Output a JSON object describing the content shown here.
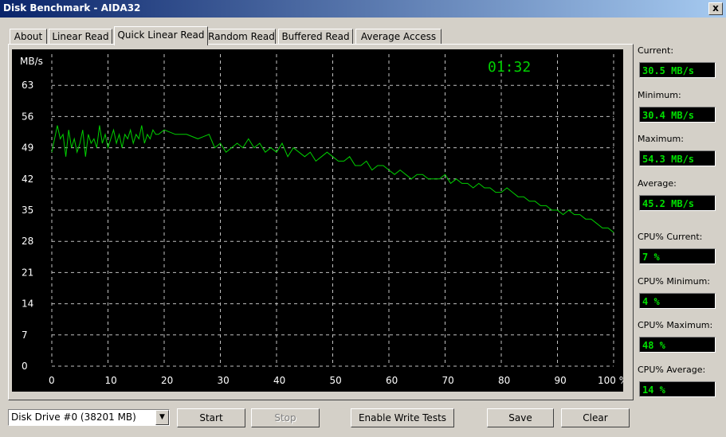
{
  "window": {
    "title": "Disk Benchmark - AIDA32",
    "close_label": "x"
  },
  "tabs": [
    {
      "label": "About",
      "active": false
    },
    {
      "label": "Linear Read",
      "active": false
    },
    {
      "label": "Quick Linear Read",
      "active": true
    },
    {
      "label": "Random Read",
      "active": false
    },
    {
      "label": "Buffered Read",
      "active": false
    },
    {
      "label": "Average Access",
      "active": false
    }
  ],
  "chart": {
    "clock": "01:32",
    "y_unit": "MB/s",
    "line_color": "#00d000",
    "grid_color": "#c0c0c0"
  },
  "chart_data": {
    "type": "line",
    "ylabel": "MB/s",
    "ylim": [
      0,
      70
    ],
    "xlim": [
      0,
      100
    ],
    "yticks": [
      "0",
      "7",
      "14",
      "21",
      "28",
      "35",
      "42",
      "49",
      "56",
      "63"
    ],
    "xticks": [
      "0",
      "10",
      "20",
      "30",
      "40",
      "50",
      "60",
      "70",
      "80",
      "90",
      "100 %"
    ],
    "grid": true,
    "series": [
      {
        "x": [
          0,
          1,
          1.5,
          2,
          2.5,
          3,
          3.5,
          4,
          4.5,
          5,
          5.5,
          6,
          6.5,
          7,
          7.5,
          8,
          8.5,
          9,
          9.5,
          10,
          10.5,
          11,
          11.5,
          12,
          12.5,
          13,
          13.5,
          14,
          14.5,
          15,
          15.5,
          16,
          16.5,
          17,
          17.5,
          18,
          18.5,
          19,
          20,
          22,
          24,
          26,
          28,
          29,
          30,
          31,
          32,
          33,
          34,
          35,
          36,
          37,
          38,
          39,
          40,
          41,
          42,
          43,
          44,
          45,
          46,
          47,
          48,
          49,
          50,
          51,
          52,
          53,
          54,
          55,
          56,
          57,
          58,
          59,
          60,
          61,
          62,
          63,
          64,
          65,
          66,
          67,
          68,
          69,
          70,
          71,
          72,
          73,
          74,
          75,
          76,
          77,
          78,
          79,
          80,
          81,
          82,
          83,
          84,
          85,
          86,
          87,
          88,
          89,
          90,
          91,
          92,
          93,
          94,
          95,
          96,
          97,
          98,
          99,
          100
        ],
        "y": [
          48,
          54,
          51,
          52,
          47,
          53,
          49,
          51,
          48,
          50,
          53,
          47,
          52,
          50,
          51,
          49,
          54,
          50,
          52,
          49,
          51,
          53,
          50,
          52,
          49,
          52,
          51,
          53,
          50,
          52,
          51,
          54,
          50,
          52,
          51,
          53,
          52,
          52,
          53,
          52,
          52,
          51,
          52,
          49,
          50,
          48,
          49,
          50,
          49,
          51,
          49,
          50,
          48,
          49,
          48,
          50,
          47,
          49,
          48,
          47,
          48,
          46,
          47,
          48,
          47,
          46,
          46,
          47,
          45,
          45,
          46,
          44,
          45,
          45,
          44,
          43,
          44,
          43,
          42,
          43,
          43,
          42,
          42,
          42,
          43,
          41,
          42,
          41,
          41,
          40,
          41,
          40,
          40,
          39,
          39,
          40,
          39,
          38,
          38,
          37,
          37,
          36,
          36,
          35,
          35,
          34,
          35,
          34,
          34,
          33,
          33,
          32,
          31,
          31,
          30
        ]
      }
    ]
  },
  "stats": [
    {
      "label": "Current:",
      "value": "30.5 MB/s"
    },
    {
      "label": "Minimum:",
      "value": "30.4 MB/s"
    },
    {
      "label": "Maximum:",
      "value": "54.3 MB/s"
    },
    {
      "label": "Average:",
      "value": "45.2 MB/s"
    },
    {
      "label": "CPU% Current:",
      "value": "7 %"
    },
    {
      "label": "CPU% Minimum:",
      "value": "4 %"
    },
    {
      "label": "CPU% Maximum:",
      "value": "48 %"
    },
    {
      "label": "CPU% Average:",
      "value": "14 %"
    }
  ],
  "controls": {
    "drive_select": "Disk Drive #0  (38201 MB)",
    "start": "Start",
    "stop": "Stop",
    "enable_write": "Enable Write Tests",
    "save": "Save",
    "clear": "Clear"
  }
}
